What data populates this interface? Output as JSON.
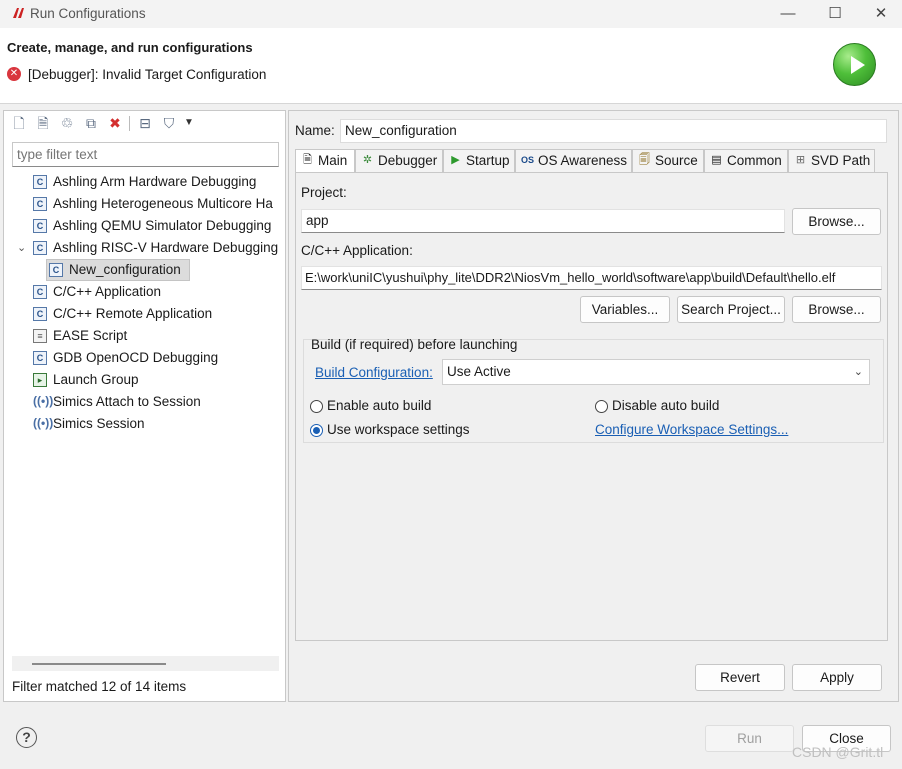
{
  "window": {
    "title": "Run Configurations",
    "minimize": "—",
    "maximize": "☐",
    "close": "✕"
  },
  "header": {
    "heading": "Create, manage, and run configurations",
    "error": "[Debugger]: Invalid Target Configuration"
  },
  "left": {
    "filter_placeholder": "type filter text",
    "tree": [
      {
        "label": "Ashling Arm Hardware Debugging",
        "icon": "c"
      },
      {
        "label": "Ashling Heterogeneous Multicore Ha",
        "icon": "c"
      },
      {
        "label": "Ashling QEMU Simulator Debugging",
        "icon": "c"
      },
      {
        "label": "Ashling RISC-V Hardware Debugging",
        "icon": "c"
      },
      {
        "label": "New_configuration",
        "icon": "c"
      },
      {
        "label": "C/C++ Application",
        "icon": "c"
      },
      {
        "label": "C/C++ Remote Application",
        "icon": "c"
      },
      {
        "label": "EASE Script",
        "icon": "script"
      },
      {
        "label": "GDB OpenOCD Debugging",
        "icon": "c"
      },
      {
        "label": "Launch Group",
        "icon": "launch"
      },
      {
        "label": "Simics Attach to Session",
        "icon": "simics"
      },
      {
        "label": "Simics Session",
        "icon": "simics"
      }
    ],
    "status": "Filter matched 12 of 14 items"
  },
  "right": {
    "name_label": "Name:",
    "name_value": "New_configuration",
    "tabs": [
      "Main",
      "Debugger",
      "Startup",
      "OS Awareness",
      "Source",
      "Common",
      "SVD Path"
    ],
    "project_label": "Project:",
    "project_value": "app",
    "browse": "Browse...",
    "app_label": "C/C++ Application:",
    "app_value": "E:\\work\\uniIC\\yushui\\phy_lite\\DDR2\\NiosVm_hello_world\\software\\app\\build\\Default\\hello.elf",
    "variables": "Variables...",
    "search_project": "Search Project...",
    "build_group_title": "Build (if required) before launching",
    "build_config_link": "Build Configuration:",
    "build_config_value": "Use Active",
    "enable_auto_build": "Enable auto build",
    "disable_auto_build": "Disable auto build",
    "use_workspace": "Use workspace settings",
    "configure_workspace": "Configure Workspace Settings...",
    "revert": "Revert",
    "apply": "Apply"
  },
  "footer": {
    "run": "Run",
    "close": "Close",
    "help": "?"
  },
  "watermark": "CSDN @Grit.tl"
}
